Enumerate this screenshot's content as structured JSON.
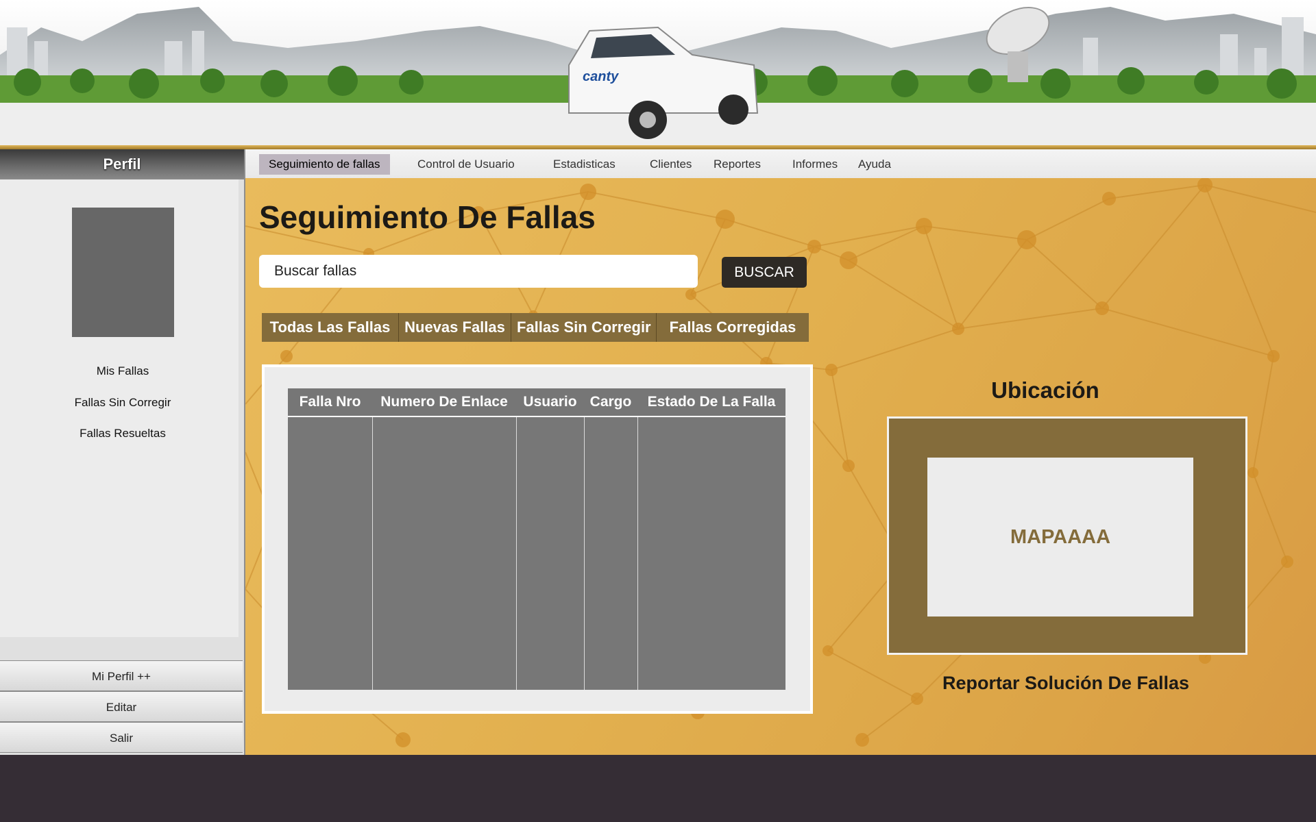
{
  "nav": {
    "items": [
      {
        "label": "Seguimiento de fallas",
        "active": true
      },
      {
        "label": "Control de Usuario"
      },
      {
        "label": "Estadisticas"
      },
      {
        "label": "Clientes"
      },
      {
        "label": "Reportes"
      },
      {
        "label": "Informes"
      },
      {
        "label": "Ayuda"
      }
    ]
  },
  "banner": {
    "truck_logo": "canty"
  },
  "sidebar": {
    "title": "Perfil",
    "links": [
      "Mis Fallas",
      "Fallas Sin Corregir",
      "Fallas Resueltas"
    ],
    "buttons": [
      "Mi Perfil ++",
      "Editar",
      "Salir"
    ]
  },
  "main": {
    "title": "Seguimiento De Fallas",
    "search": {
      "value": "Buscar fallas",
      "button": "BUSCAR"
    },
    "filters": [
      "Todas Las Fallas",
      "Nuevas Fallas",
      "Fallas Sin Corregir",
      "Fallas Corregidas"
    ],
    "table": {
      "columns": [
        "Falla Nro",
        "Numero De Enlace",
        "Usuario",
        "Cargo",
        "Estado De La Falla"
      ]
    },
    "location": {
      "title": "Ubicación",
      "map_label": "MAPAAAA",
      "report_link": "Reportar Solución De Fallas"
    }
  },
  "colors": {
    "accent_brown": "#846c3b",
    "background_gold": "#e2b04f",
    "footer": "#352d35"
  }
}
